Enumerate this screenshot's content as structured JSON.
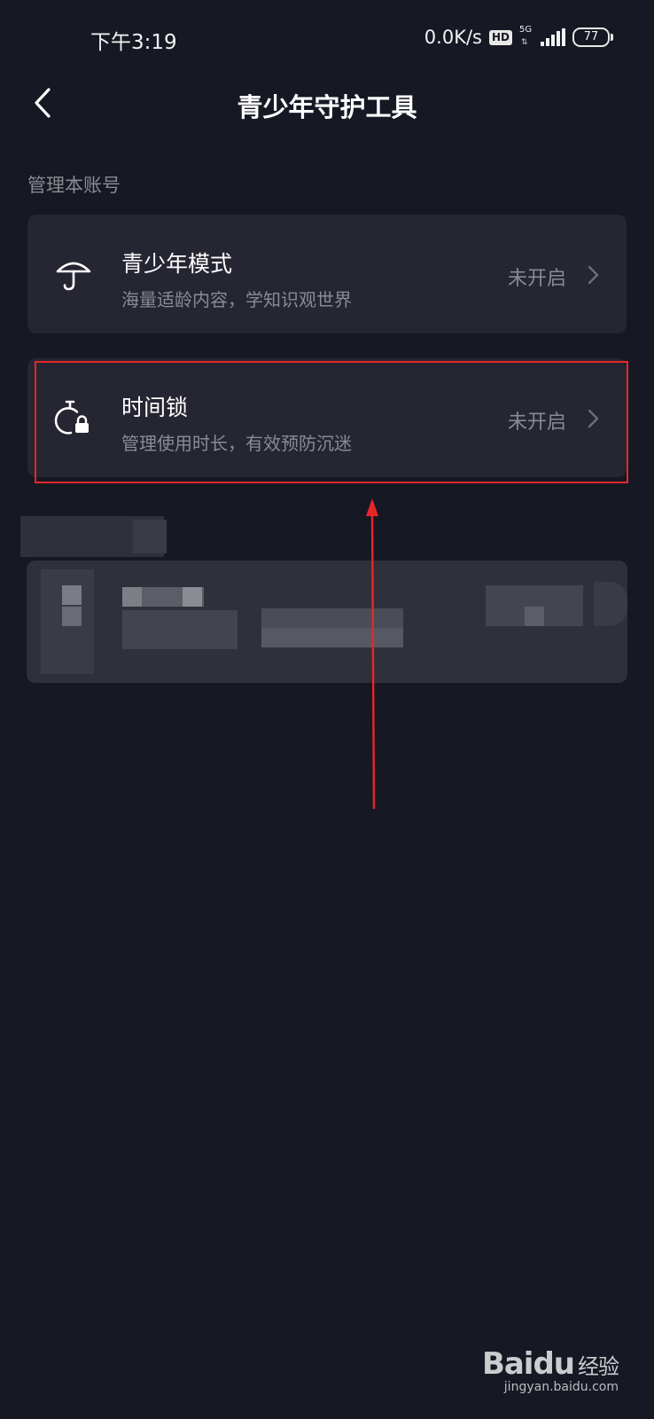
{
  "status_bar": {
    "time": "下午3:19",
    "net_speed": "0.0K/s",
    "hd": "HD",
    "network": "5G",
    "battery": "77"
  },
  "nav": {
    "title": "青少年守护工具",
    "back_icon": "chevron-left-icon"
  },
  "section": {
    "label": "管理本账号"
  },
  "items": [
    {
      "title": "青少年模式",
      "subtitle": "海量适龄内容，学知识观世界",
      "status": "未开启",
      "icon": "umbrella-icon"
    },
    {
      "title": "时间锁",
      "subtitle": "管理使用时长，有效预防沉迷",
      "status": "未开启",
      "icon": "timer-lock-icon"
    }
  ],
  "annotation_color": "#e8262a",
  "watermark": {
    "logo": "Baidu",
    "logo_suffix": "经验",
    "url": "jingyan.baidu.com"
  }
}
